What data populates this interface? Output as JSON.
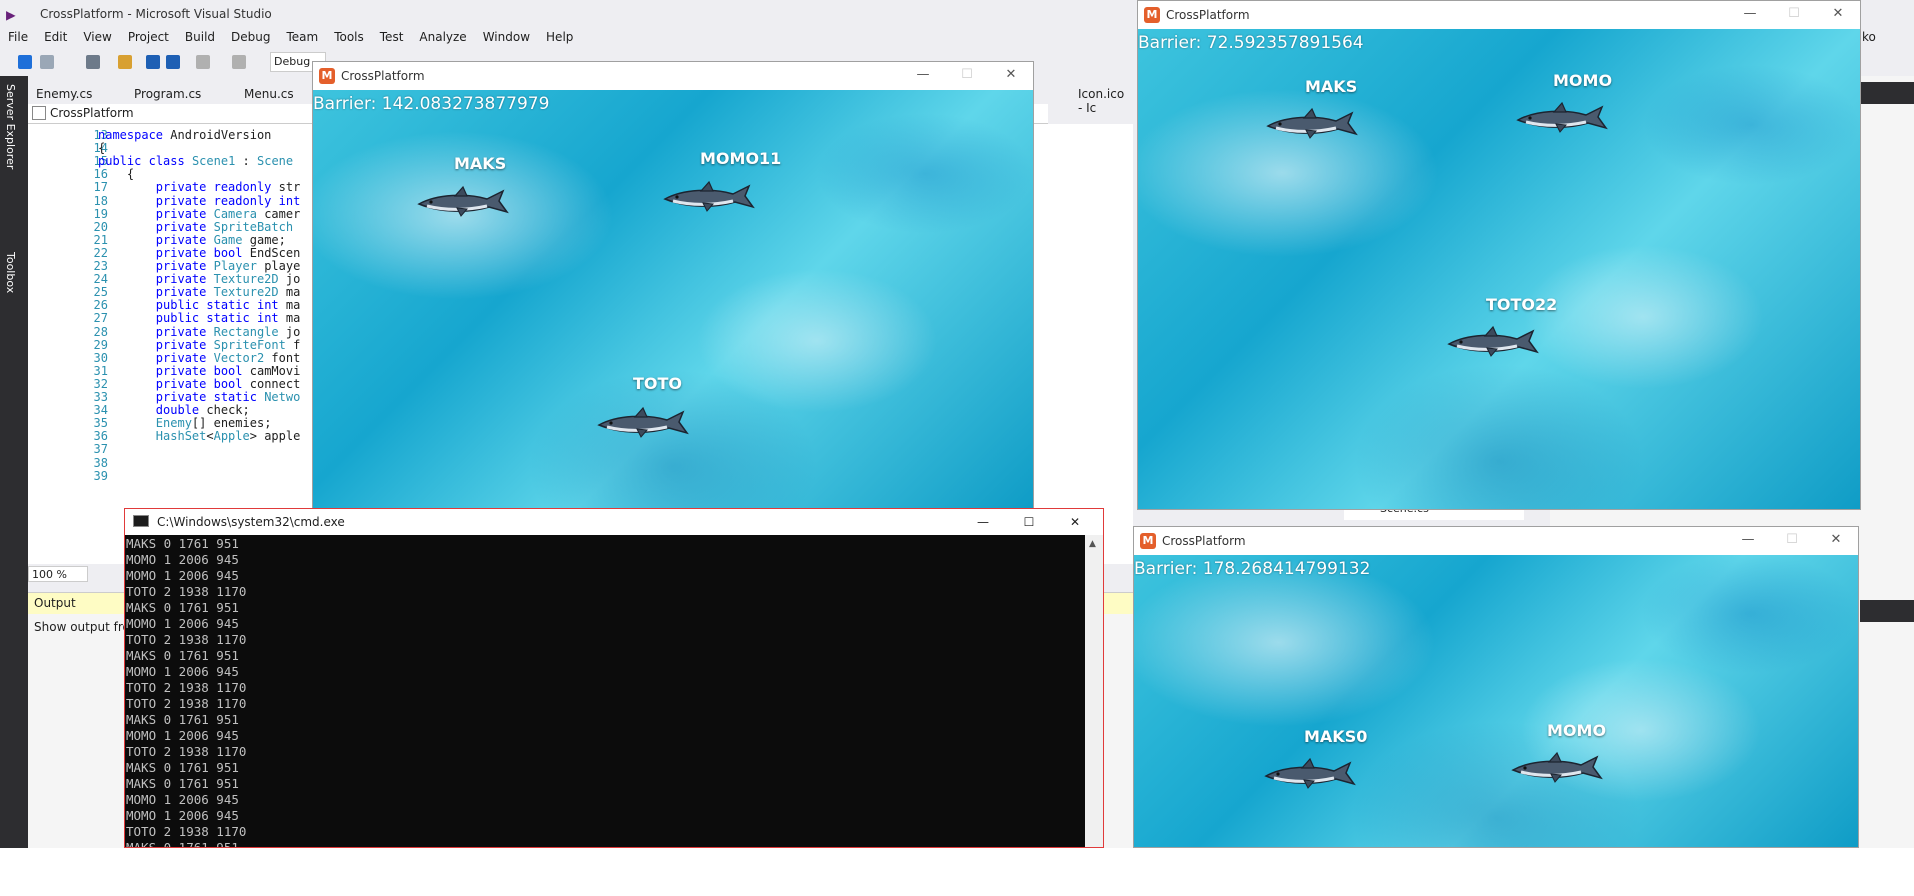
{
  "vs": {
    "title": "CrossPlatform - Microsoft Visual Studio",
    "menu": [
      "File",
      "Edit",
      "View",
      "Project",
      "Build",
      "Debug",
      "Team",
      "Tools",
      "Test",
      "Analyze",
      "Window",
      "Help"
    ],
    "config": "Debug",
    "left_tabs": [
      "Server Explorer",
      "Toolbox"
    ],
    "tabs": [
      "Enemy.cs",
      "Program.cs",
      "Menu.cs",
      "Icon.ico - Ic"
    ],
    "nav_project": "CrossPlatform",
    "line_numbers": [
      "13",
      "14",
      "15",
      "16",
      "17",
      "18",
      "19",
      "20",
      "21",
      "22",
      "23",
      "24",
      "25",
      "26",
      "27",
      "28",
      "29",
      "30",
      "31",
      "32",
      "33",
      "34",
      "35",
      "36",
      "37",
      "38",
      "39"
    ],
    "code": [
      "namespace AndroidVersion",
      "{",
      "public class Scene1 : Scene",
      "    {",
      "        private readonly str",
      "        private readonly int",
      "        private Camera camer",
      "        private SpriteBatch",
      "        private Game game;",
      "        private bool EndScen",
      "        private Player playe",
      "        private Texture2D jo",
      "        private Texture2D ma",
      "        public static int ma",
      "        public static int ma",
      "        private Rectangle jo",
      "        private SpriteFont f",
      "        private Vector2 font",
      "        private bool camMovi",
      "        private bool connect",
      "        private static Netwo",
      "        double check;",
      "        Enemy[] enemies;",
      "        HashSet<Apple> apple",
      "",
      "",
      ""
    ],
    "zoom": "100 %",
    "output_label": "Output",
    "output_from": "Show output fro",
    "solution_item": "Scene.cs",
    "user_short": "ko"
  },
  "game_windows": [
    {
      "title": "CrossPlatform",
      "barrier": "Barrier: 142.083273877979",
      "players": [
        "MAKS",
        "MOMO11",
        "TOTO"
      ]
    },
    {
      "title": "CrossPlatform",
      "barrier": "Barrier: 72.592357891564",
      "players": [
        "MAKS",
        "MOMO",
        "TOTO22"
      ]
    },
    {
      "title": "CrossPlatform",
      "barrier": "Barrier: 178.268414799132",
      "players": [
        "MAKS0",
        "MOMO"
      ]
    }
  ],
  "cmd": {
    "title": "C:\\Windows\\system32\\cmd.exe",
    "lines": [
      "MAKS 0 1761 951",
      "MOMO 1 2006 945",
      "MOMO 1 2006 945",
      "TOTO 2 1938 1170",
      "MAKS 0 1761 951",
      "MOMO 1 2006 945",
      "TOTO 2 1938 1170",
      "MAKS 0 1761 951",
      "MOMO 1 2006 945",
      "TOTO 2 1938 1170",
      "TOTO 2 1938 1170",
      "MAKS 0 1761 951",
      "MOMO 1 2006 945",
      "TOTO 2 1938 1170",
      "MAKS 0 1761 951",
      "MAKS 0 1761 951",
      "MOMO 1 2006 945",
      "MOMO 1 2006 945",
      "TOTO 2 1938 1170",
      "MAKS 0 1761 951"
    ]
  },
  "icons": {
    "minimize": "minimize-icon",
    "maximize": "maximize-icon",
    "close": "close-icon"
  }
}
